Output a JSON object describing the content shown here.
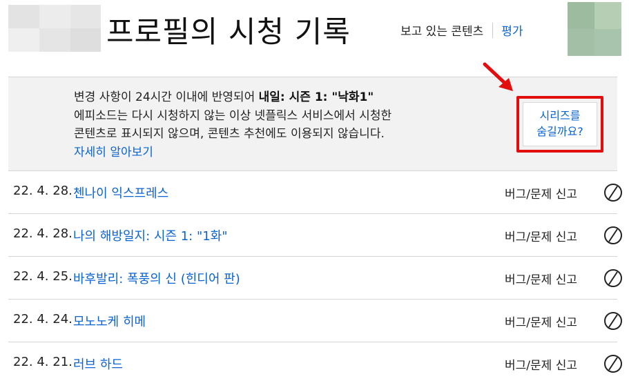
{
  "header": {
    "title": "프로필의 시청 기록",
    "nav_current": "보고 있는 콘텐츠",
    "nav_link": "평가"
  },
  "notice": {
    "line1_prefix": "변경 사항이 24시간 이내에 반영되어 ",
    "line1_bold": "내일: 시즌 1: \"낙화1\"",
    "line2": "에피소드는 다시 시청하지 않는 이상 넷플릭스 서비스에서 시청한",
    "line3": "콘텐츠로 표시되지 않으며, 콘텐츠 추천에도 이용되지 않습니다.",
    "learn_more": "자세히 알아보기",
    "hide_series_line1": "시리즈를",
    "hide_series_line2": "숨길까요?"
  },
  "history": [
    {
      "date": "22. 4. 28.",
      "title": "첸나이 익스프레스",
      "report": "버그/문제 신고"
    },
    {
      "date": "22. 4. 28.",
      "title": "나의 해방일지: 시즌 1: \"1화\"",
      "report": "버그/문제 신고"
    },
    {
      "date": "22. 4. 25.",
      "title": "바후발리: 폭풍의 신 (힌디어 판)",
      "report": "버그/문제 신고"
    },
    {
      "date": "22. 4. 24.",
      "title": "모노노케 히메",
      "report": "버그/문제 신고"
    },
    {
      "date": "22. 4. 21.",
      "title": "러브 하드",
      "report": "버그/문제 신고"
    }
  ],
  "colors": {
    "link": "#0a63d1",
    "highlight": "#e20e0e",
    "notice_bg": "#f2f2f2"
  },
  "icons": {
    "hide_row": "circle-slash-icon",
    "annotation": "red-arrow-icon"
  }
}
